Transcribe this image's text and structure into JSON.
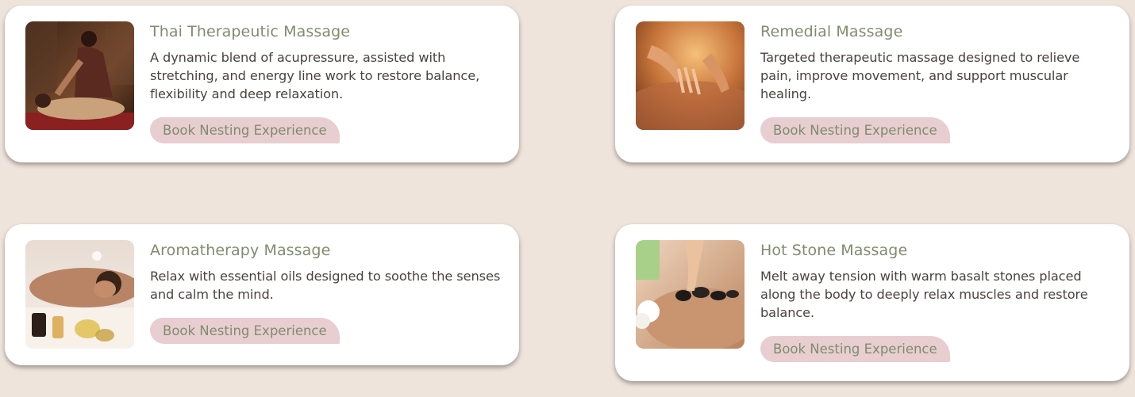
{
  "cards": [
    {
      "title": "Thai Therapeutic Massage",
      "description": "A dynamic blend of acupressure, assisted with stretching, and energy line work to restore balance, flexibility and deep relaxation.",
      "button_label": "Book Nesting Experience",
      "image": "thai-massage-photo"
    },
    {
      "title": "Remedial Massage",
      "description": "Targeted therapeutic massage designed to relieve pain, improve movement, and support muscular healing.",
      "button_label": "Book Nesting Experience",
      "image": "remedial-massage-photo"
    },
    {
      "title": "Aromatherapy Massage",
      "description": "Relax with essential oils designed to soothe the senses and calm the mind.",
      "button_label": "Book Nesting Experience",
      "image": "aromatherapy-massage-photo"
    },
    {
      "title": "Hot Stone Massage",
      "description": "Melt away tension with warm basalt stones placed along the body to deeply relax muscles and restore balance.",
      "button_label": "Book Nesting Experience",
      "image": "hot-stone-massage-photo"
    }
  ],
  "colors": {
    "page_background": "#efe4dc",
    "card_background": "#ffffff",
    "title": "#7f8c6e",
    "text": "#4a4340",
    "button_background": "#e8ced1"
  }
}
